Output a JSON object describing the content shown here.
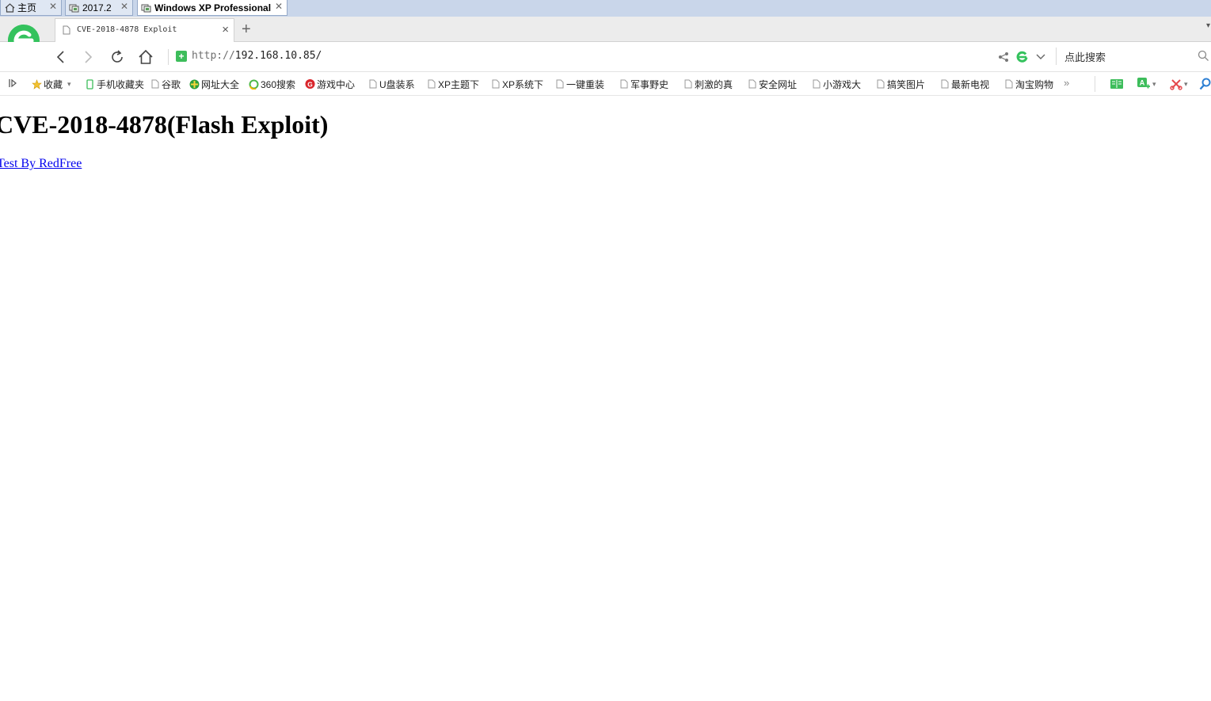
{
  "vm_tabs": [
    {
      "label": "主页",
      "icon": "home-icon"
    },
    {
      "label": "2017.2",
      "icon": "vm-icon"
    },
    {
      "label": "Windows XP Professional",
      "icon": "vm-icon",
      "active": true
    }
  ],
  "browser": {
    "tab_title": "CVE-2018-4878 Exploit",
    "new_tab": "+",
    "url_protocol": "http://",
    "url_host": "192.168.10.85/",
    "search_placeholder": "点此搜索",
    "bookmarks": [
      {
        "label": "收藏",
        "icon": "star-icon"
      },
      {
        "label": "手机收藏夹",
        "icon": "phone-icon"
      },
      {
        "label": "谷歌",
        "icon": "page-icon"
      },
      {
        "label": "网址大全",
        "icon": "site-nav-icon"
      },
      {
        "label": "360搜索",
        "icon": "search-360-icon"
      },
      {
        "label": "游戏中心",
        "icon": "game-icon"
      },
      {
        "label": "U盘装系",
        "icon": "page-icon"
      },
      {
        "label": "XP主题下",
        "icon": "page-icon"
      },
      {
        "label": "XP系统下",
        "icon": "page-icon"
      },
      {
        "label": "一键重装",
        "icon": "page-icon"
      },
      {
        "label": "军事野史",
        "icon": "page-icon"
      },
      {
        "label": "刺激的真",
        "icon": "page-icon"
      },
      {
        "label": "安全网址",
        "icon": "page-icon"
      },
      {
        "label": "小游戏大",
        "icon": "page-icon"
      },
      {
        "label": "搞笑图片",
        "icon": "page-icon"
      },
      {
        "label": "最新电视",
        "icon": "page-icon"
      },
      {
        "label": "淘宝购物",
        "icon": "page-icon"
      }
    ],
    "bookmarks_more": "»"
  },
  "page": {
    "heading": "CVE-2018-4878(Flash Exploit)",
    "link_text": "Test By RedFree"
  },
  "colors": {
    "browser_green": "#3dbd5b",
    "link_blue": "#0000ee",
    "vm_tab_bar": "#c9d6ea"
  }
}
